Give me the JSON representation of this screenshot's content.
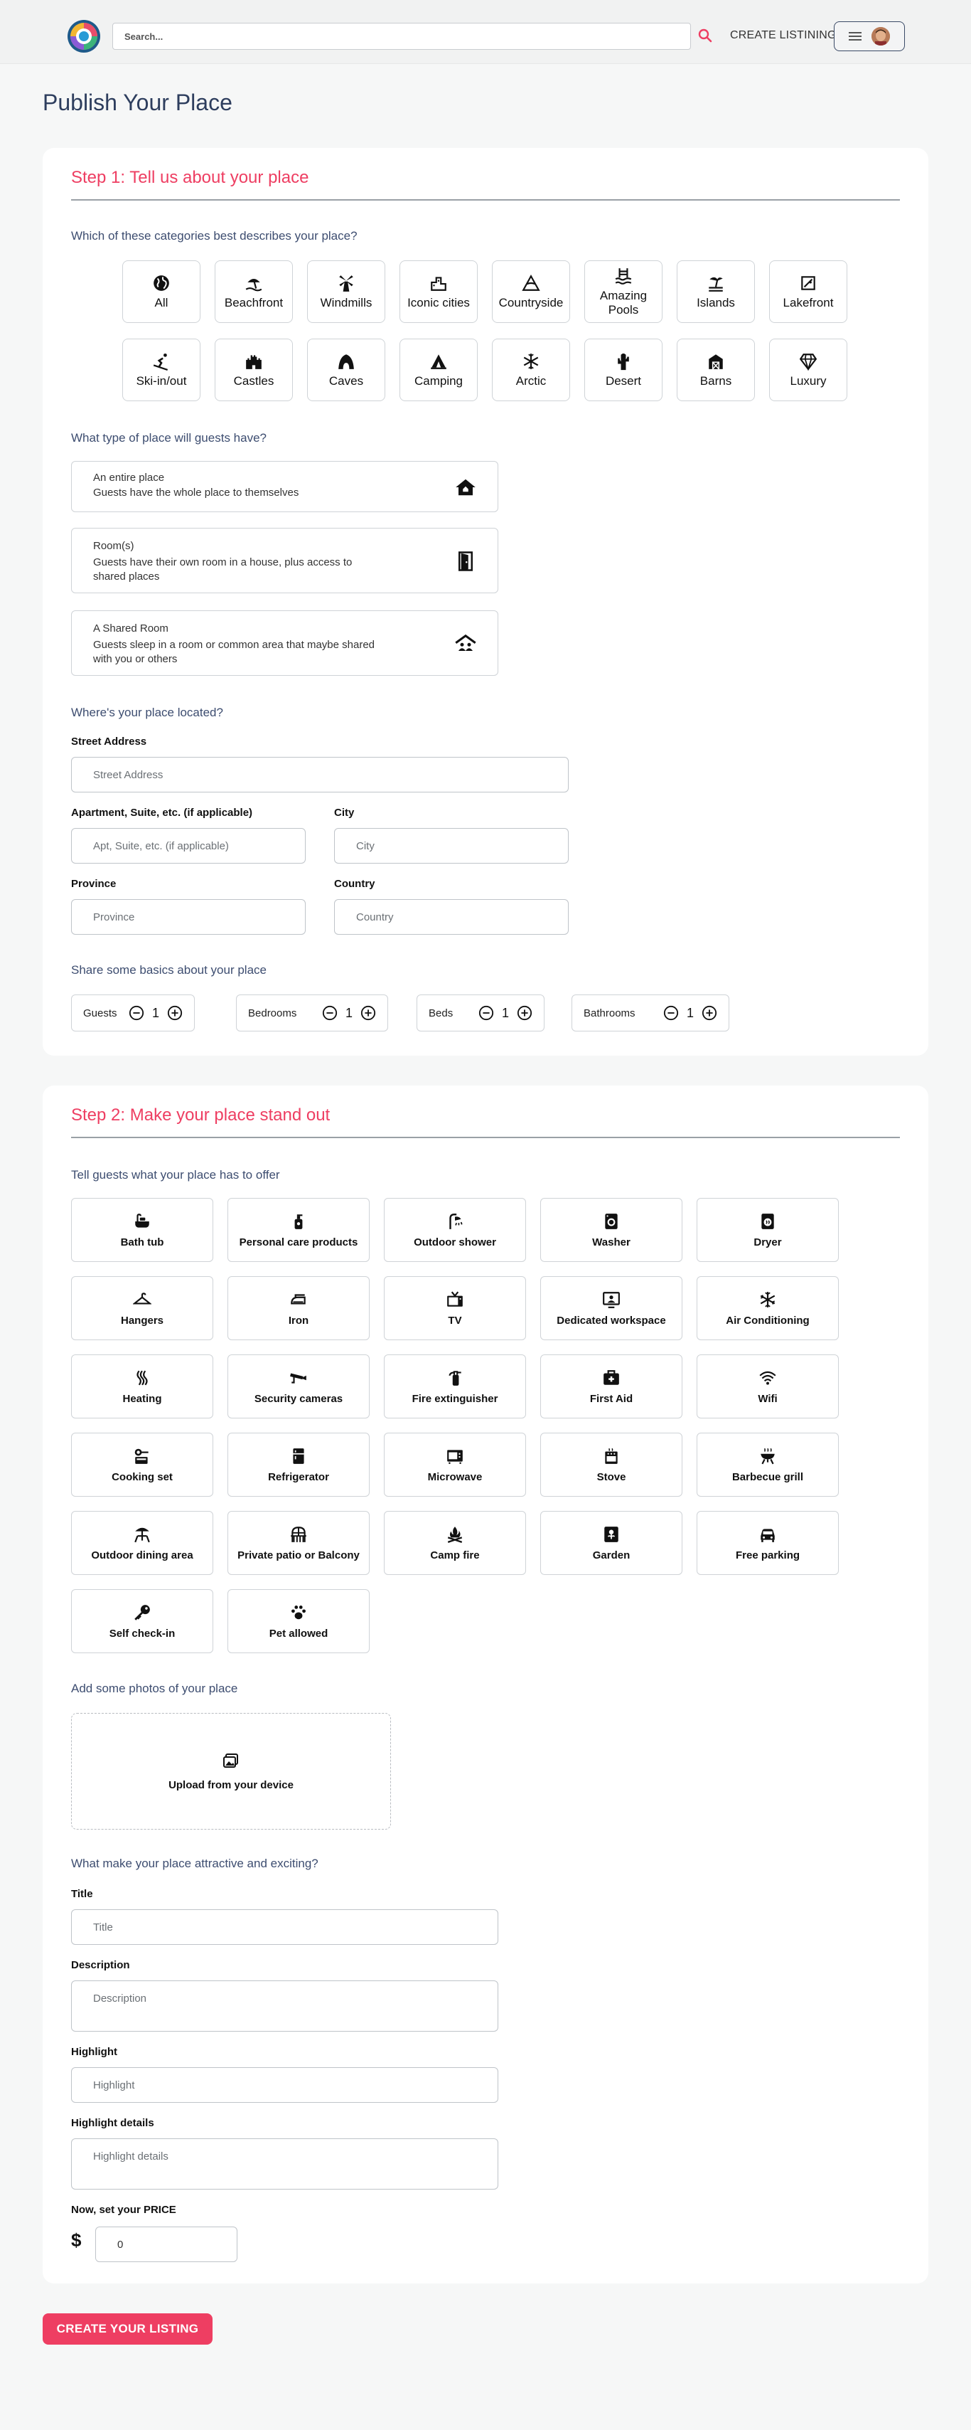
{
  "header": {
    "search_placeholder": "Search...",
    "create_listing_label": "CREATE LISTINING"
  },
  "page_title": "Publish Your Place",
  "step1": {
    "title": "Step 1: Tell us about your place",
    "categories_question": "Which of these categories best describes your place?",
    "categories": [
      "All",
      "Beachfront",
      "Windmills",
      "Iconic cities",
      "Countryside",
      "Amazing Pools",
      "Islands",
      "Lakefront",
      "Ski-in/out",
      "Castles",
      "Caves",
      "Camping",
      "Arctic",
      "Desert",
      "Barns",
      "Luxury"
    ],
    "type_question": "What type of place will guests have?",
    "place_types": [
      {
        "title": "An entire place",
        "desc": "Guests have the whole place to themselves"
      },
      {
        "title": "Room(s)",
        "desc": "Guests have their own room in a house, plus access to shared places"
      },
      {
        "title": "A Shared Room",
        "desc": "Guests sleep in a room or common area that maybe shared with you or others"
      }
    ],
    "location_question": "Where's your place located?",
    "address": {
      "street_label": "Street Address",
      "street_placeholder": "Street Address",
      "apt_label": "Apartment, Suite, etc. (if applicable)",
      "apt_placeholder": "Apt, Suite, etc. (if applicable)",
      "city_label": "City",
      "city_placeholder": "City",
      "province_label": "Province",
      "province_placeholder": "Province",
      "country_label": "Country",
      "country_placeholder": "Country"
    },
    "basics_question": "Share some basics about your place",
    "basics": [
      {
        "label": "Guests",
        "value": "1"
      },
      {
        "label": "Bedrooms",
        "value": "1"
      },
      {
        "label": "Beds",
        "value": "1"
      },
      {
        "label": "Bathrooms",
        "value": "1"
      }
    ]
  },
  "step2": {
    "title": "Step 2: Make your place stand out",
    "offer_question": "Tell guests what your place has to offer",
    "amenities": [
      "Bath tub",
      "Personal care products",
      "Outdoor shower",
      "Washer",
      "Dryer",
      "Hangers",
      "Iron",
      "TV",
      "Dedicated workspace",
      "Air Conditioning",
      "Heating",
      "Security cameras",
      "Fire extinguisher",
      "First Aid",
      "Wifi",
      "Cooking set",
      "Refrigerator",
      "Microwave",
      "Stove",
      "Barbecue grill",
      "Outdoor dining area",
      "Private patio or Balcony",
      "Camp fire",
      "Garden",
      "Free parking",
      "Self check-in",
      "Pet allowed"
    ],
    "photos_question": "Add some photos of your place",
    "upload_label": "Upload from your device",
    "attract_question": "What make your place attractive and exciting?",
    "title_label": "Title",
    "title_placeholder": "Title",
    "description_label": "Description",
    "description_placeholder": "Description",
    "highlight_label": "Highlight",
    "highlight_placeholder": "Highlight",
    "highlight_details_label": "Highlight details",
    "highlight_details_placeholder": "Highlight details",
    "price_label": "Now, set your PRICE",
    "currency_symbol": "$",
    "price_value": "0"
  },
  "cta_label": "CREATE YOUR LISTING",
  "colors": {
    "accent": "#ee3e62",
    "heading": "#2e3e5e"
  }
}
